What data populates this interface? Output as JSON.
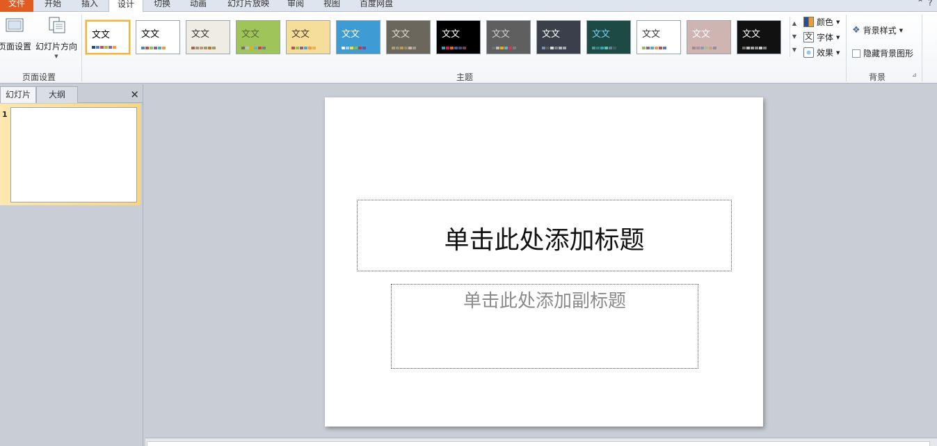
{
  "tabs": [
    {
      "label": "文件"
    },
    {
      "label": "开始"
    },
    {
      "label": "插入"
    },
    {
      "label": "设计"
    },
    {
      "label": "切换"
    },
    {
      "label": "动画"
    },
    {
      "label": "幻灯片放映"
    },
    {
      "label": "审阅"
    },
    {
      "label": "视图"
    },
    {
      "label": "百度网盘"
    }
  ],
  "ribbon": {
    "page_setup": {
      "page_setup_label": "页面设置",
      "orientation_label": "幻灯片方向",
      "group_label": "页面设置"
    },
    "themes": {
      "group_label": "主题",
      "sample_text": "文文",
      "items": [
        {
          "bg": "#ffffff",
          "fg": "#000000",
          "colors": [
            "#1f497d",
            "#4f81bd",
            "#c0504d",
            "#9bbb59",
            "#8064a2",
            "#f79646"
          ]
        },
        {
          "bg": "#ffffff",
          "fg": "#000000",
          "colors": [
            "#4f81bd",
            "#c0504d",
            "#9bbb59",
            "#8064a2",
            "#4bacc6",
            "#f79646"
          ]
        },
        {
          "bg": "#efede3",
          "fg": "#333333",
          "colors": [
            "#a5644e",
            "#b58b80",
            "#c3986d",
            "#a19574",
            "#c17529",
            "#9a9a6e"
          ]
        },
        {
          "bg": "#9fc55a",
          "fg": "#556b2f",
          "colors": [
            "#6f6f6f",
            "#bfbfbf",
            "#f0ad00",
            "#60b5cc",
            "#e6324b",
            "#6f8183"
          ]
        },
        {
          "bg": "#f5dd9c",
          "fg": "#4b3a1a",
          "colors": [
            "#c0504d",
            "#9bbb59",
            "#8064a2",
            "#4bacc6",
            "#f79646",
            "#e7b643"
          ]
        },
        {
          "bg": "#3e9bd4",
          "fg": "#ffffff",
          "colors": [
            "#ffffff",
            "#a9d3ec",
            "#f4e31f",
            "#7cbd52",
            "#c53a2f",
            "#6f4e9b"
          ]
        },
        {
          "bg": "#6b675c",
          "fg": "#e0dccf",
          "colors": [
            "#b09b6e",
            "#8f9181",
            "#c29c52",
            "#8e8b77",
            "#c8b79a",
            "#9e9b86"
          ]
        },
        {
          "bg": "#000000",
          "fg": "#ffffff",
          "colors": [
            "#2da2bf",
            "#da1f28",
            "#eb641b",
            "#39639d",
            "#474b78",
            "#7d3c4a"
          ]
        },
        {
          "bg": "#5f5f5f",
          "fg": "#cfcfcf",
          "colors": [
            "#6f6f6f",
            "#bfbfbf",
            "#f0ad00",
            "#60b5cc",
            "#e6324b",
            "#6f8183"
          ]
        },
        {
          "bg": "#3b3f4b",
          "fg": "#ffffff",
          "colors": [
            "#7f8fa9",
            "#5a5a5a",
            "#dddddd",
            "#818385",
            "#aab8c4",
            "#a6a6a6"
          ]
        },
        {
          "bg": "#1d4a44",
          "fg": "#7fd0e6",
          "colors": [
            "#4e9d8c",
            "#3a7d7a",
            "#2ea1c2",
            "#5fc4ad",
            "#6b7d8f",
            "#3e5e62"
          ]
        },
        {
          "bg": "#ffffff",
          "fg": "#333333",
          "colors": [
            "#9bbb59",
            "#8064a2",
            "#4bacc6",
            "#f79646",
            "#c0504d",
            "#4f81bd"
          ]
        },
        {
          "bg": "#cfb5b1",
          "fg": "#ffffff",
          "colors": [
            "#a28c7a",
            "#b08fa0",
            "#8b9aa8",
            "#a6bc96",
            "#c5a37f",
            "#988a9c"
          ]
        },
        {
          "bg": "#111111",
          "fg": "#ffffff",
          "colors": [
            "#6f6f6f",
            "#bfbfbf",
            "#a6a6a6",
            "#8c8c8c",
            "#cccccc",
            "#7f7f7f"
          ]
        }
      ]
    },
    "color_label": "颜色",
    "font_label": "字体",
    "effect_label": "效果",
    "background": {
      "style_label": "背景样式",
      "hide_graphics_label": "隐藏背景图形",
      "group_label": "背景"
    }
  },
  "left_pane": {
    "tab_slides": "幻灯片",
    "tab_outline": "大纲",
    "slide_number": "1"
  },
  "slide": {
    "title_placeholder": "单击此处添加标题",
    "subtitle_placeholder": "单击此处添加副标题"
  }
}
